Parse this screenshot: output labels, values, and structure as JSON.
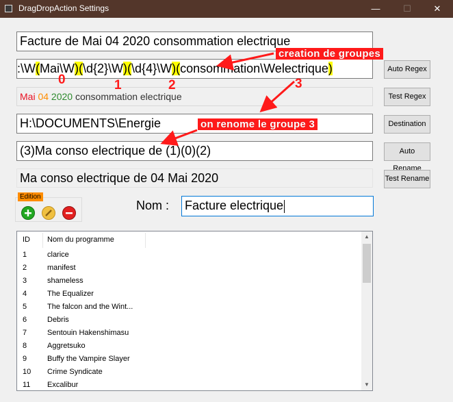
{
  "window": {
    "title": "DragDropAction Settings",
    "minimize": "—",
    "maximize": "☐",
    "close": "✕"
  },
  "source_name": "Facture de Mai 04 2020 consommation electrique",
  "regex": {
    "parts": [
      ":\\W",
      "(",
      "Mai\\W",
      ")",
      "(",
      "\\d{2}\\W",
      ")",
      "(",
      "\\d{4}\\W",
      ")",
      "(",
      "consommation\\Welectrique",
      ")"
    ]
  },
  "test_result": {
    "month": "Mai",
    "day": "04",
    "year": "2020",
    "rest": "consommation electrique",
    "colors": {
      "month": "#e81123",
      "day": "#ff8c00",
      "year": "#2e8b2e",
      "rest": "#333333"
    }
  },
  "destination": "H:\\DOCUMENTS\\Energie",
  "rename_pattern": "(3)Ma conso electrique de (1)(0)(2)",
  "rename_result": "Ma conso electrique de 04 Mai 2020",
  "buttons": {
    "auto_regex": "Auto Regex",
    "test_regex": "Test Regex",
    "destination": "Destination",
    "auto_rename": "Auto Rename",
    "test_rename": "Test Rename"
  },
  "annotations": {
    "groups_label": "creation de groupes",
    "rename_label": "on renome le groupe 3",
    "num0": "0",
    "num1": "1",
    "num2": "2",
    "num3": "3",
    "color": "#ff1a1a"
  },
  "edition": {
    "legend": "Edition",
    "add_icon": "add-circle-icon",
    "edit_icon": "pencil-icon",
    "remove_icon": "minus-circle-icon"
  },
  "name_field": {
    "label": "Nom :",
    "value": "Facture electrique"
  },
  "programs": {
    "columns": [
      "ID",
      "Nom du programme"
    ],
    "rows": [
      {
        "id": "1",
        "name": "clarice"
      },
      {
        "id": "2",
        "name": "manifest"
      },
      {
        "id": "3",
        "name": "shameless"
      },
      {
        "id": "4",
        "name": "The Equalizer"
      },
      {
        "id": "5",
        "name": "The falcon and the Wint..."
      },
      {
        "id": "6",
        "name": "Debris"
      },
      {
        "id": "7",
        "name": "Sentouin Hakenshimasu"
      },
      {
        "id": "8",
        "name": "Aggretsuko"
      },
      {
        "id": "9",
        "name": "Buffy the Vampire Slayer"
      },
      {
        "id": "10",
        "name": "Crime Syndicate"
      },
      {
        "id": "11",
        "name": "Excalibur"
      }
    ]
  }
}
